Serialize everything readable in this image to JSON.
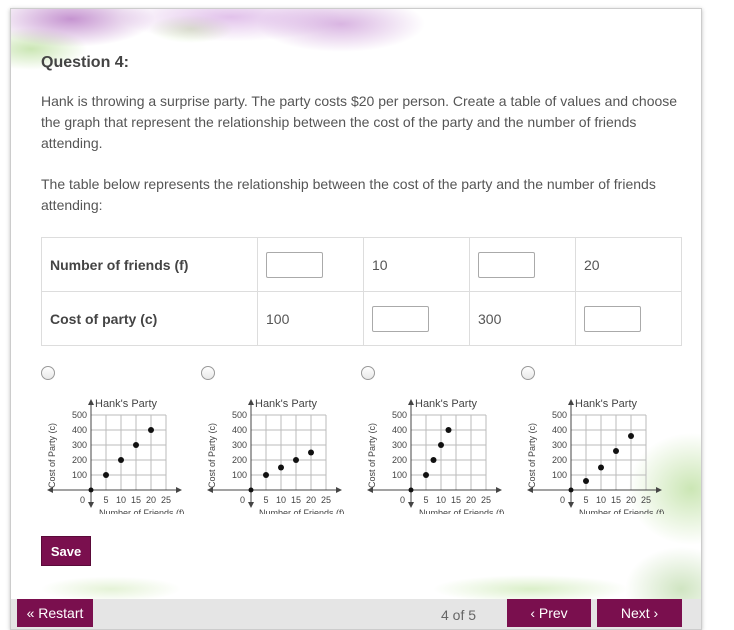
{
  "question": {
    "title": "Question 4:",
    "paragraph1": "Hank is throwing a surprise party. The party costs $20 per person. Create a table of values and choose the graph that represent the relationship between the cost of the party and the number of friends attending.",
    "paragraph2": "The table below represents the relationship between the cost of the party and the number of friends attending:"
  },
  "table": {
    "row1": {
      "header": "Number of friends (f)",
      "cells": [
        "",
        "10",
        "",
        "20"
      ]
    },
    "row2": {
      "header": "Cost of party (c)",
      "cells": [
        "100",
        "",
        "300",
        ""
      ]
    }
  },
  "chart_data": [
    {
      "type": "scatter",
      "title": "Hank's Party",
      "xlabel": "Number of Friends (f)",
      "ylabel": "Cost of Party (c)",
      "xlim": [
        0,
        25
      ],
      "ylim": [
        0,
        500
      ],
      "x_ticks": [
        "5",
        "10",
        "15",
        "20",
        "25"
      ],
      "y_ticks": [
        "100",
        "200",
        "300",
        "400",
        "500"
      ],
      "origin_label": "0",
      "points": [
        [
          5,
          100
        ],
        [
          10,
          200
        ],
        [
          15,
          300
        ],
        [
          20,
          400
        ]
      ]
    },
    {
      "type": "scatter",
      "title": "Hank's Party",
      "xlabel": "Number of Friends (f)",
      "ylabel": "Cost of Party (c)",
      "xlim": [
        0,
        25
      ],
      "ylim": [
        0,
        500
      ],
      "x_ticks": [
        "5",
        "10",
        "15",
        "20",
        "25"
      ],
      "y_ticks": [
        "100",
        "200",
        "300",
        "400",
        "500"
      ],
      "origin_label": "0",
      "points": [
        [
          5,
          100
        ],
        [
          10,
          150
        ],
        [
          15,
          200
        ],
        [
          20,
          250
        ]
      ]
    },
    {
      "type": "scatter",
      "title": "Hank's Party",
      "xlabel": "Number of Friends (f)",
      "ylabel": "Cost of Party (c)",
      "xlim": [
        0,
        25
      ],
      "ylim": [
        0,
        500
      ],
      "x_ticks": [
        "5",
        "10",
        "15",
        "20",
        "25"
      ],
      "y_ticks": [
        "100",
        "200",
        "300",
        "400",
        "500"
      ],
      "origin_label": "0",
      "points": [
        [
          5,
          100
        ],
        [
          7.5,
          200
        ],
        [
          10,
          300
        ],
        [
          12.5,
          400
        ]
      ]
    },
    {
      "type": "scatter",
      "title": "Hank's Party",
      "xlabel": "Number of Friends (f)",
      "ylabel": "Cost of Party (c)",
      "xlim": [
        0,
        25
      ],
      "ylim": [
        0,
        500
      ],
      "x_ticks": [
        "5",
        "10",
        "15",
        "20",
        "25"
      ],
      "y_ticks": [
        "100",
        "200",
        "300",
        "400",
        "500"
      ],
      "origin_label": "0",
      "points": [
        [
          5,
          60
        ],
        [
          10,
          150
        ],
        [
          15,
          260
        ],
        [
          20,
          360
        ]
      ]
    }
  ],
  "buttons": {
    "save": "Save",
    "restart": "« Restart",
    "prev": "‹ Prev",
    "next": "Next ›"
  },
  "pagination": "4 of 5"
}
